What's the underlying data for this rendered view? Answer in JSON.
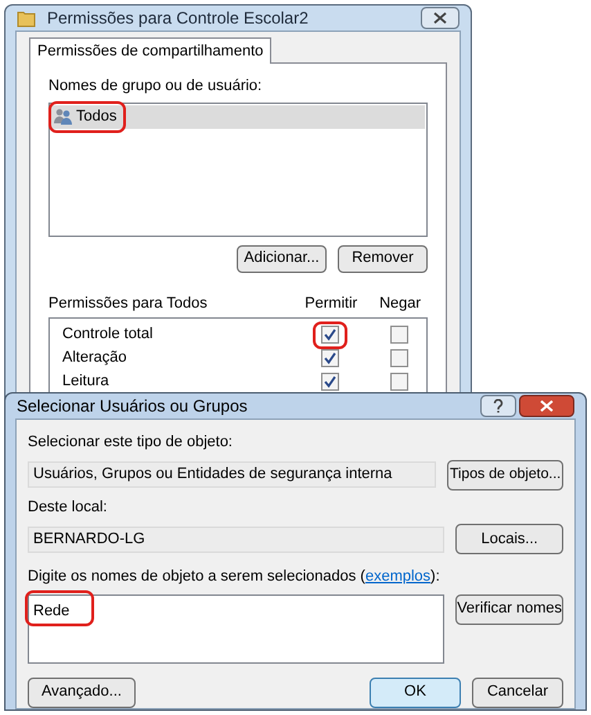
{
  "back_window": {
    "title": "Permissões para Controle Escolar2",
    "tabs": [
      {
        "label": "Permissões de compartilhamento",
        "selected": true
      }
    ],
    "groups_label": "Nomes de grupo ou de usuário:",
    "groups": [
      {
        "name": "Todos",
        "selected": true,
        "circled": true
      }
    ],
    "buttons": [
      "Adicionar...",
      "Remover"
    ],
    "permissions_label": "Permissões para Todos",
    "allow_header": "Permitir",
    "deny_header": "Negar",
    "permissions": [
      {
        "name": "Controle total",
        "allow": true,
        "deny": false,
        "allow_circled": true
      },
      {
        "name": "Alteração",
        "allow": true,
        "deny": false,
        "allow_circled": false
      },
      {
        "name": "Leitura",
        "allow": true,
        "deny": false,
        "allow_circled": false
      }
    ]
  },
  "dialog": {
    "title": "Selecionar Usuários ou Grupos",
    "object_type_label": "Selecionar este tipo de objeto:",
    "object_type": "Usuários, Grupos ou Entidades de segurança interna",
    "object_type_button": "Tipos de objeto...",
    "location_label": "Deste local:",
    "location": "BERNARDO-LG",
    "location_button": "Locais...",
    "names_label": "Digite os nomes de objeto a serem selecionados (",
    "names_link": "exemplos",
    "names_label_end": "):",
    "names_value": "Rede",
    "names_circled": true,
    "check_button": "Verificar nomes",
    "advanced_button": "Avançado...",
    "ok_button": "OK",
    "cancel_button": "Cancelar"
  }
}
